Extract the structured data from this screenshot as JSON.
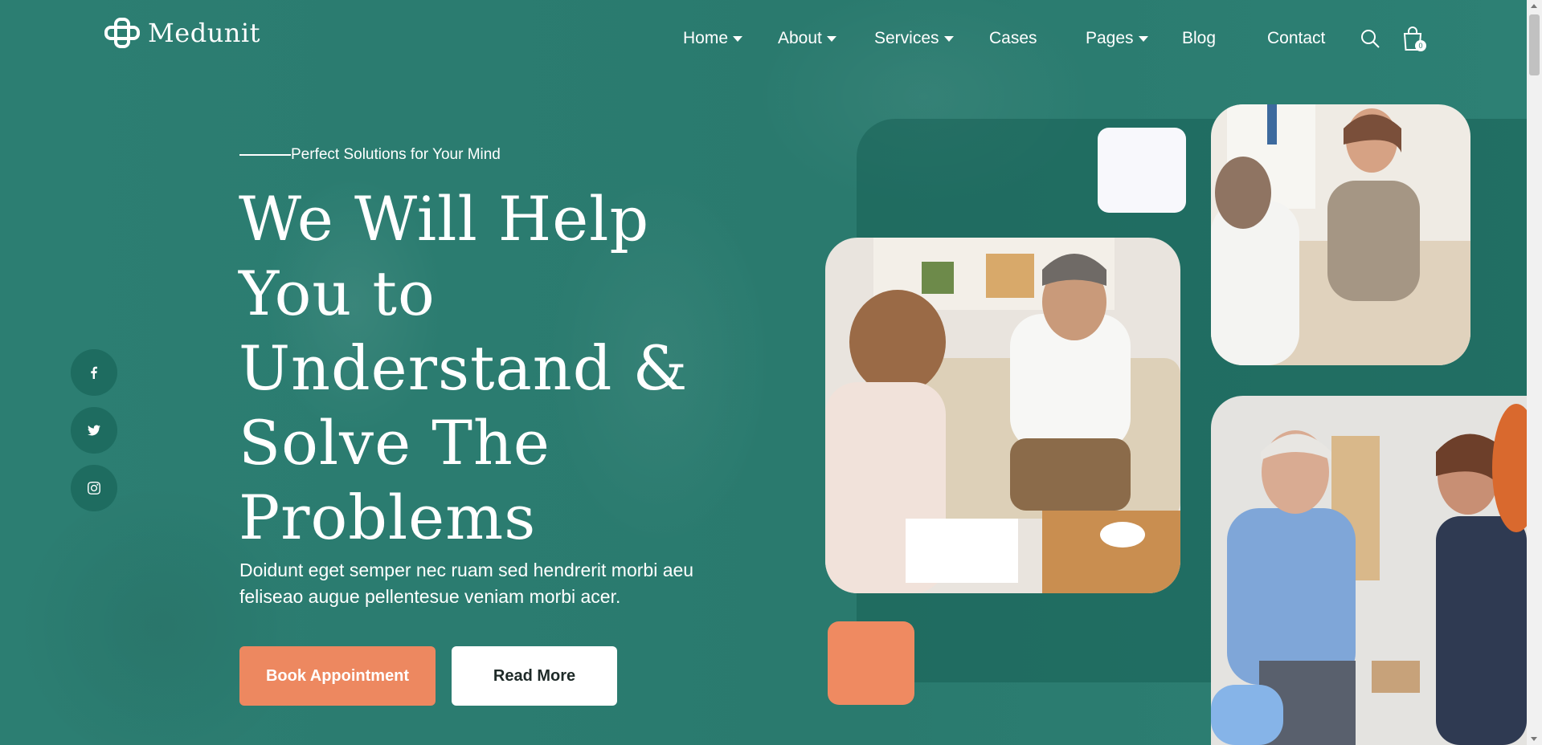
{
  "brand": {
    "name": "Medunit",
    "icon": "medical-cross-logo"
  },
  "nav": {
    "items": [
      {
        "label": "Home",
        "has_dropdown": true
      },
      {
        "label": "About",
        "has_dropdown": true
      },
      {
        "label": "Services",
        "has_dropdown": true
      },
      {
        "label": "Cases",
        "has_dropdown": false
      },
      {
        "label": "Pages",
        "has_dropdown": true
      },
      {
        "label": "Blog",
        "has_dropdown": false
      },
      {
        "label": "Contact",
        "has_dropdown": false
      }
    ],
    "cart_count": "0"
  },
  "social": [
    "facebook-icon",
    "twitter-icon",
    "instagram-icon"
  ],
  "hero": {
    "tagline": "Perfect Solutions for Your Mind",
    "title": "We Will Help You to Understand & Solve The Problems",
    "subtitle": "Doidunt eget semper nec ruam sed hendrerit morbi aeu feliseao augue pellentesue veniam morbi acer.",
    "primary_button": "Book Appointment",
    "secondary_button": "Read More"
  },
  "colors": {
    "background": "#2a7c70",
    "accent": "#ed8860",
    "social_bg": "#1e6c60"
  }
}
